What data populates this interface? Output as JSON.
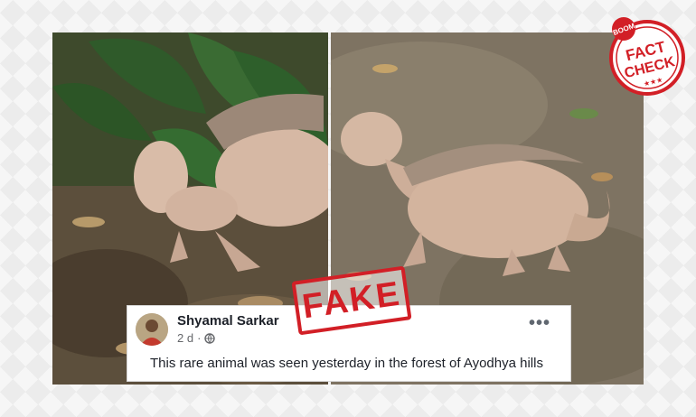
{
  "post": {
    "author": "Shyamal Sarkar",
    "time": "2 d",
    "dot": "·",
    "more": "•••",
    "text": "This rare animal was seen yesterday in the forest of Ayodhya hills"
  },
  "stamp": {
    "label": "FAKE"
  },
  "badge": {
    "brand": "BOOM",
    "line1": "FACT",
    "line2": "CHECK",
    "stars": "★★★"
  },
  "colors": {
    "stamp_red": "#d21f26",
    "card_bg": "#ffffff"
  }
}
